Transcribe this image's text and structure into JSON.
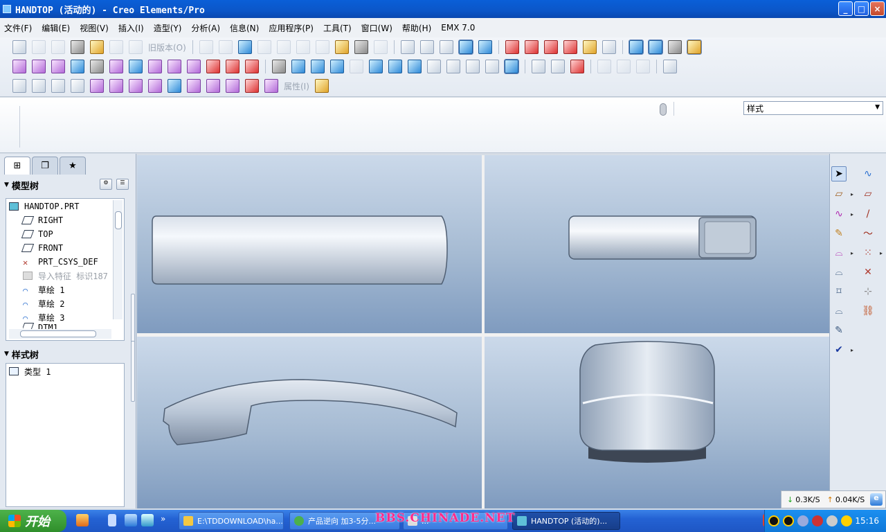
{
  "window": {
    "title": "HANDTOP (活动的) - Creo Elements/Pro",
    "controls": {
      "minimize": "_",
      "maximize": "□",
      "close": "×"
    }
  },
  "menubar": {
    "items": [
      "文件(F)",
      "编辑(E)",
      "视图(V)",
      "插入(I)",
      "造型(Y)",
      "分析(A)",
      "信息(N)",
      "应用程序(P)",
      "工具(T)",
      "窗口(W)",
      "帮助(H)",
      "EMX 7.0"
    ]
  },
  "toolbar": {
    "old_version_label": "旧版本(O)",
    "properties_label": "属性(I)"
  },
  "dashboard": {
    "style_select": "样式"
  },
  "left_panel": {
    "tabs": [
      "model-tree-tab",
      "layer-tab",
      "favorites-tab"
    ],
    "model_tree": {
      "header": "模型树",
      "items": [
        {
          "label": "HANDTOP.PRT",
          "icon": "part-icon"
        },
        {
          "label": "RIGHT",
          "icon": "datum-plane-icon"
        },
        {
          "label": "TOP",
          "icon": "datum-plane-icon"
        },
        {
          "label": "FRONT",
          "icon": "datum-plane-icon"
        },
        {
          "label": "PRT_CSYS_DEF",
          "icon": "csys-icon"
        },
        {
          "label": "导入特征 标识187",
          "icon": "import-feature-icon"
        },
        {
          "label": "草绘 1",
          "icon": "sketch-icon"
        },
        {
          "label": "草绘 2",
          "icon": "sketch-icon"
        },
        {
          "label": "草绘 3",
          "icon": "sketch-icon"
        },
        {
          "label": "DTM1",
          "icon": "datum-plane-icon"
        }
      ]
    },
    "style_tree": {
      "header": "样式树",
      "items": [
        {
          "label": "类型 1",
          "icon": "style-type-icon"
        }
      ]
    }
  },
  "netspeed": {
    "down": "0.3K/S",
    "up": "0.04K/S"
  },
  "taskbar": {
    "start": "开始",
    "tasks": [
      {
        "label": "E:\\TDDOWNLOAD\\ha...",
        "icon": "folder-icon"
      },
      {
        "label": "产品逆向 加3-5分...",
        "icon": "browser-icon"
      },
      {
        "label": "...",
        "icon": "window-icon"
      },
      {
        "label": "HANDTOP (活动的)...",
        "icon": "creo-icon"
      }
    ],
    "watermark": "BBS.CHINADE.NET",
    "clock": "15:16"
  }
}
